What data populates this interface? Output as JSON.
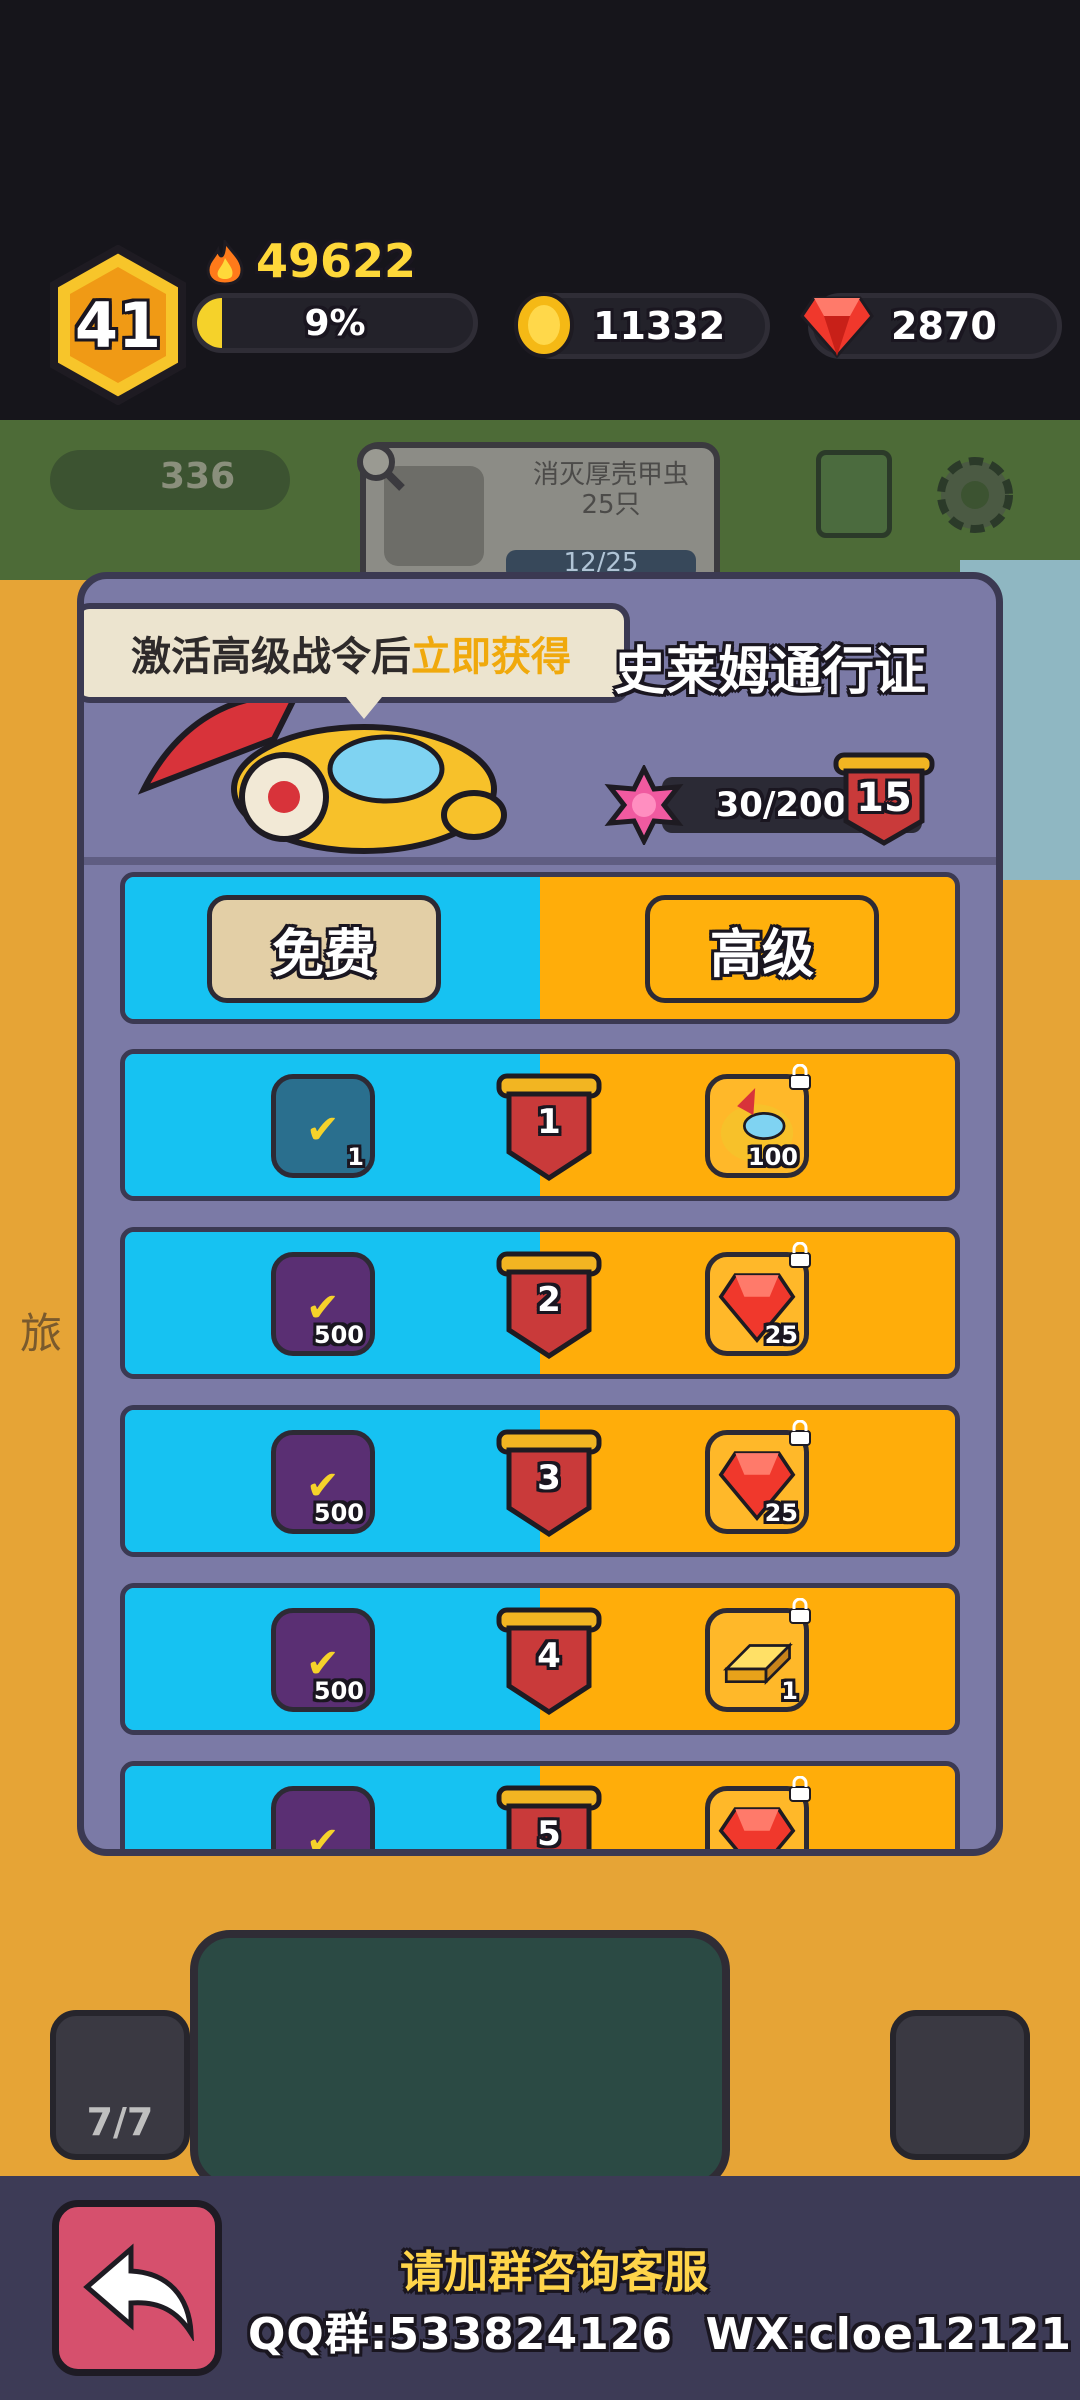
{
  "hud": {
    "player_level": "41",
    "power": "49622",
    "xp_percent": "9%",
    "xp_fill": 0.09,
    "coins": "11332",
    "gems": "2870"
  },
  "background": {
    "meat_count": "336",
    "quest_title": "消灭厚壳甲虫\n25只",
    "quest_progress": "12/25",
    "side_label": "旅",
    "slime_count": "7/7"
  },
  "battle_pass": {
    "title": "史莱姆通行证",
    "tooltip_prefix": "激活高级战令后",
    "tooltip_highlight": "立即获得",
    "points_progress": "30/200",
    "current_level": "15",
    "tab_free": "免费",
    "tab_premium": "高级",
    "rows": [
      {
        "level": "1",
        "free_qty": "1",
        "premium_qty": "100",
        "premium_icon": "slime-avatar-icon"
      },
      {
        "level": "2",
        "free_qty": "500",
        "premium_qty": "25",
        "premium_icon": "ruby-gem-icon"
      },
      {
        "level": "3",
        "free_qty": "500",
        "premium_qty": "25",
        "premium_icon": "ruby-gem-icon"
      },
      {
        "level": "4",
        "free_qty": "500",
        "premium_qty": "1",
        "premium_icon": "gold-bar-icon"
      },
      {
        "level": "5",
        "free_qty": "",
        "premium_qty": "",
        "premium_icon": "ruby-gem-icon"
      }
    ]
  },
  "bottom": {
    "help_title": "请加群咨询客服",
    "contact": "QQ群:533824126  WX:cloe12121"
  },
  "colors": {
    "free_blue": "#16c2f2",
    "premium_orange": "#ffad0a",
    "panel_purple": "#7b7aa6",
    "back_button_pink": "#d6506d",
    "highlight_yellow": "#ffd54a"
  }
}
